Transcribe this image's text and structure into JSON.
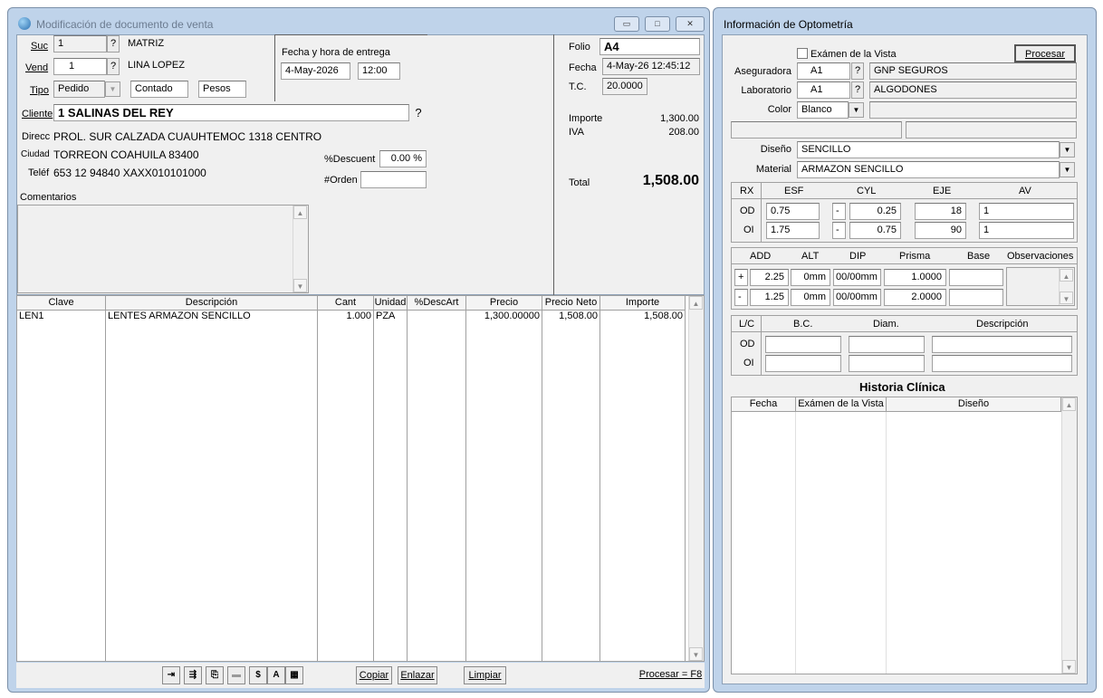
{
  "left_window": {
    "title": "Modificación de documento de venta",
    "suc": {
      "label": "Suc",
      "value": "1",
      "name": "MATRIZ"
    },
    "vend": {
      "label": "Vend",
      "value": "1",
      "name": "LINA LOPEZ"
    },
    "tipo": {
      "label": "Tipo",
      "value": "Pedido",
      "payment": "Contado",
      "currency": "Pesos"
    },
    "entrega": {
      "label": "Fecha y hora de entrega",
      "date": "4-May-2026",
      "time": "12:00"
    },
    "folio": {
      "label": "Folio",
      "value": "A4"
    },
    "fecha": {
      "label": "Fecha",
      "value": "4-May-26 12:45:12"
    },
    "tc": {
      "label": "T.C.",
      "value": "20.0000"
    },
    "importe": {
      "label": "Importe",
      "value": "1,300.00"
    },
    "iva": {
      "label": "IVA",
      "value": "208.00"
    },
    "total": {
      "label": "Total",
      "value": "1,508.00"
    },
    "cliente": {
      "label": "Cliente",
      "value": "1 SALINAS DEL REY"
    },
    "direcc": {
      "label": "Direcc",
      "value": "PROL. SUR CALZADA CUAUHTEMOC 1318 CENTRO"
    },
    "ciudad": {
      "label": "Ciudad",
      "value": "TORREON COAHUILA 83400"
    },
    "telef": {
      "label": "Teléf",
      "value": "653 12 94840 XAXX010101000"
    },
    "descuento": {
      "label": "%Descuent",
      "value": "0.00 %"
    },
    "orden": {
      "label": "#Orden",
      "value": ""
    },
    "comentarios_label": "Comentarios",
    "table": {
      "headers": [
        "Clave",
        "Descripción",
        "Cant",
        "Unidad",
        "%DescArt",
        "Precio",
        "Precio Neto",
        "Importe"
      ],
      "rows": [
        {
          "clave": "LEN1",
          "desc": "LENTES ARMAZON SENCILLO",
          "cant": "1.000",
          "unidad": "PZA",
          "descart": "",
          "precio": "1,300.00000",
          "neto": "1,508.00",
          "importe": "1,508.00"
        }
      ]
    },
    "buttons": {
      "copiar": "Copiar",
      "enlazar": "Enlazar",
      "limpiar": "Limpiar",
      "procesar": "Procesar = F8"
    },
    "tools": {
      "dollar": "$",
      "a": "A"
    }
  },
  "right_window": {
    "title": "Información de Optometría",
    "examen_label": "Exámen de la Vista",
    "procesar": "Procesar",
    "aseguradora": {
      "label": "Aseguradora",
      "code": "A1",
      "name": "GNP SEGUROS"
    },
    "laboratorio": {
      "label": "Laboratorio",
      "code": "A1",
      "name": "ALGODONES"
    },
    "color": {
      "label": "Color",
      "value": "Blanco"
    },
    "diseno": {
      "label": "Diseño",
      "value": "SENCILLO"
    },
    "material": {
      "label": "Material",
      "value": "ARMAZON SENCILLO"
    },
    "rx": {
      "headers": [
        "RX",
        "ESF",
        "CYL",
        "EJE",
        "AV"
      ],
      "od": {
        "label": "OD",
        "esf": "0.75",
        "sign": "-",
        "cyl": "0.25",
        "eje": "18",
        "av": "1"
      },
      "oi": {
        "label": "OI",
        "esf": "1.75",
        "sign": "-",
        "cyl": "0.75",
        "eje": "90",
        "av": "1"
      }
    },
    "add": {
      "headers": [
        "ADD",
        "ALT",
        "DIP",
        "Prisma",
        "Base",
        "Observaciones"
      ],
      "r1": {
        "sign": "+",
        "add": "2.25",
        "alt": "0mm",
        "dip": "00/00mm",
        "prisma": "1.0000"
      },
      "r2": {
        "sign": "-",
        "add": "1.25",
        "alt": "0mm",
        "dip": "00/00mm",
        "prisma": "2.0000"
      }
    },
    "lc": {
      "headers": [
        "L/C",
        "B.C.",
        "Diam.",
        "Descripción"
      ],
      "od": "OD",
      "oi": "OI"
    },
    "historia": {
      "title": "Historia Clínica",
      "headers": [
        "Fecha",
        "Exámen de la Vista",
        "Diseño"
      ]
    }
  }
}
